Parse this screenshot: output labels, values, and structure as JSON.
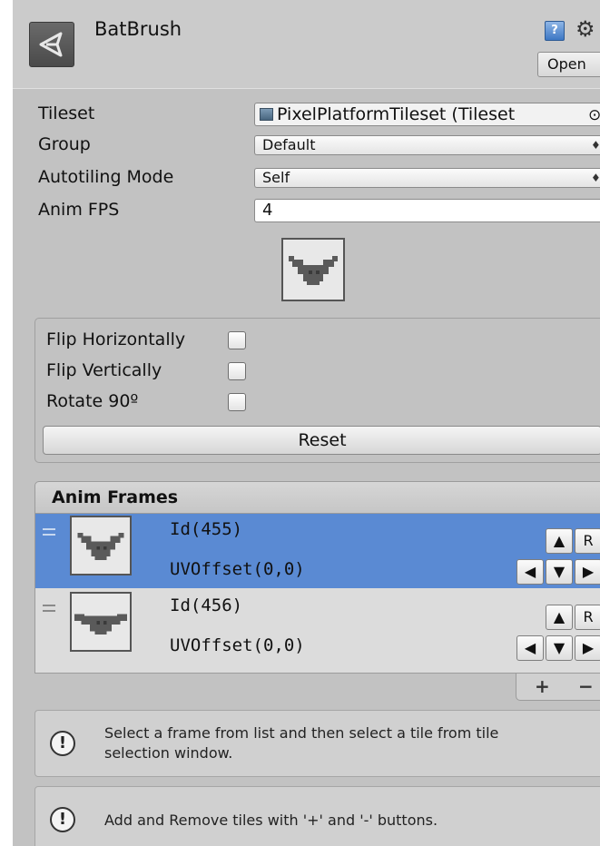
{
  "header": {
    "title": "BatBrush",
    "help_icon_text": "?",
    "gear_icon": "⚙",
    "open_label": "Open"
  },
  "properties": {
    "tileset_label": "Tileset",
    "tileset_value": "PixelPlatformTileset (Tileset",
    "tileset_picker": "⊙",
    "group_label": "Group",
    "group_value": "Default",
    "autotiling_label": "Autotiling Mode",
    "autotiling_value": "Self",
    "anim_fps_label": "Anim FPS",
    "anim_fps_value": "4"
  },
  "transform": {
    "flip_h_label": "Flip Horizontally",
    "flip_v_label": "Flip Vertically",
    "rotate_label": "Rotate 90º",
    "reset_label": "Reset"
  },
  "anim_frames": {
    "header": "Anim Frames",
    "frames": [
      {
        "id": "Id(455)",
        "uv": "UVOffset(0,0)"
      },
      {
        "id": "Id(456)",
        "uv": "UVOffset(0,0)"
      }
    ],
    "btn_up": "▲",
    "btn_r": "R",
    "btn_left": "◀",
    "btn_down": "▼",
    "btn_right": "▶",
    "add_label": "+",
    "remove_label": "−"
  },
  "help": {
    "info_icon": "!",
    "message1_line1": "Select a frame from list and then select a tile from tile",
    "message1_line2": "selection window.",
    "message2": "Add and Remove tiles with '+' and '-' buttons."
  },
  "colors": {
    "inspector_bg": "#c2c2c2",
    "selected_row": "#5a8ad3",
    "bat_sprite": "#5a5a5a",
    "bat_body": "#3a3a3a"
  }
}
